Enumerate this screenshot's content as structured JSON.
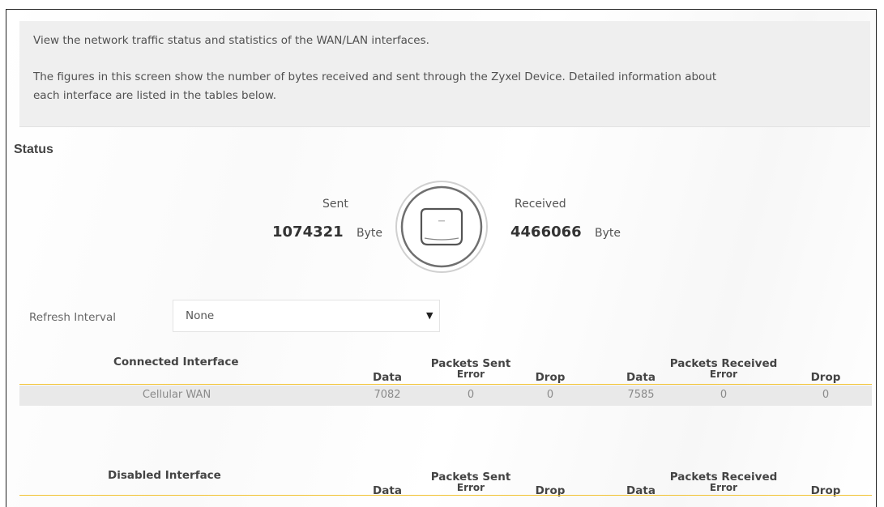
{
  "intro": {
    "line1": "View the network traffic status and statistics of the WAN/LAN interfaces.",
    "line2": "The figures in this screen show the number of bytes received and sent through the Zyxel Device. Detailed information about",
    "line3": "each interface are listed in the tables below."
  },
  "status": {
    "title": "Status",
    "sent_label": "Sent",
    "sent_value": "1074321",
    "sent_unit": "Byte",
    "received_label": "Received",
    "received_value": "4466066",
    "received_unit": "Byte",
    "device_icon": "router-device-icon"
  },
  "refresh": {
    "label": "Refresh Interval",
    "value": "None"
  },
  "connected_table": {
    "title": "Connected Interface",
    "packets_sent": "Packets Sent",
    "packets_received": "Packets Received",
    "col_data": "Data",
    "col_error": "Error",
    "col_drop": "Drop",
    "rows": [
      {
        "name": "Cellular WAN",
        "sent_data": "7082",
        "sent_error": "0",
        "sent_drop": "0",
        "recv_data": "7585",
        "recv_error": "0",
        "recv_drop": "0"
      }
    ]
  },
  "disabled_table": {
    "title": "Disabled Interface",
    "packets_sent": "Packets Sent",
    "packets_received": "Packets Received",
    "col_data": "Data",
    "col_error": "Error",
    "col_drop": "Drop"
  },
  "colors": {
    "accent_line": "#f1c232",
    "row_bg": "#e9e9e9",
    "info_bg": "#efefef"
  }
}
